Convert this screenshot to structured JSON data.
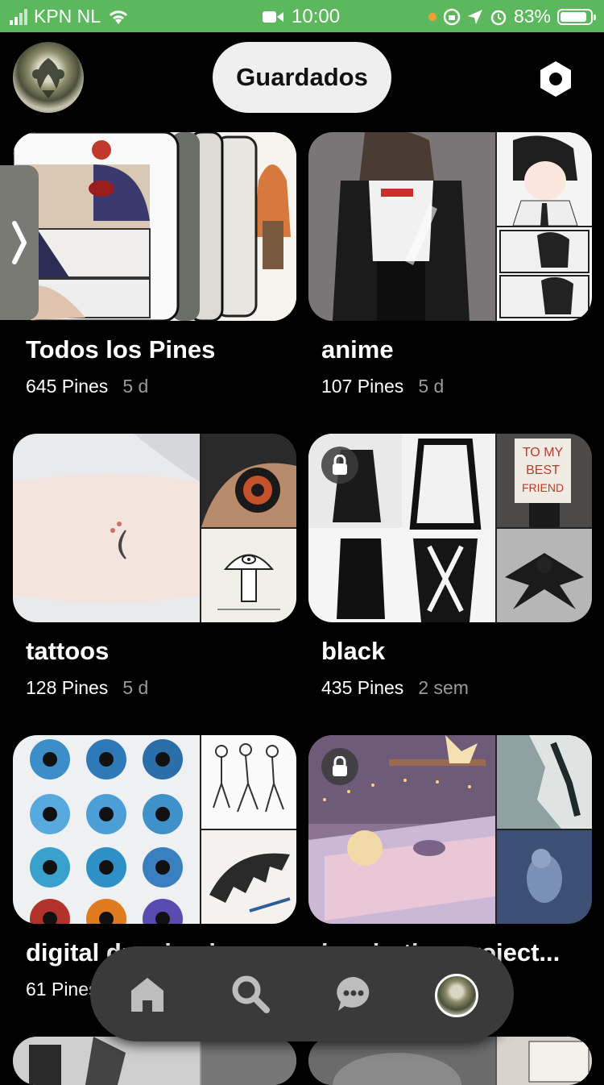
{
  "status_bar": {
    "carrier": "KPN NL",
    "time": "10:00",
    "battery": "83%"
  },
  "header": {
    "active_tab": "Guardados"
  },
  "boards": [
    {
      "title": "Todos los Pines",
      "pins": "645 Pines",
      "age": "5 d",
      "secret": false
    },
    {
      "title": "anime",
      "pins": "107 Pines",
      "age": "5 d",
      "secret": false
    },
    {
      "title": "tattoos",
      "pins": "128 Pines",
      "age": "5 d",
      "secret": false
    },
    {
      "title": "black",
      "pins": "435 Pines",
      "age": "2 sem",
      "secret": true
    },
    {
      "title": "digital drawing i...",
      "pins": "61 Pines",
      "age": "",
      "secret": false
    },
    {
      "title": "inspiration project...",
      "pins": "",
      "age": "",
      "secret": true
    }
  ],
  "bottom_nav": {
    "items": [
      "home-icon",
      "search-icon",
      "messages-icon",
      "profile-avatar"
    ]
  },
  "colors": {
    "status_bar": "#5cb85c",
    "background": "#000000",
    "pill": "#efefef",
    "nav": "#3a3a3a"
  }
}
